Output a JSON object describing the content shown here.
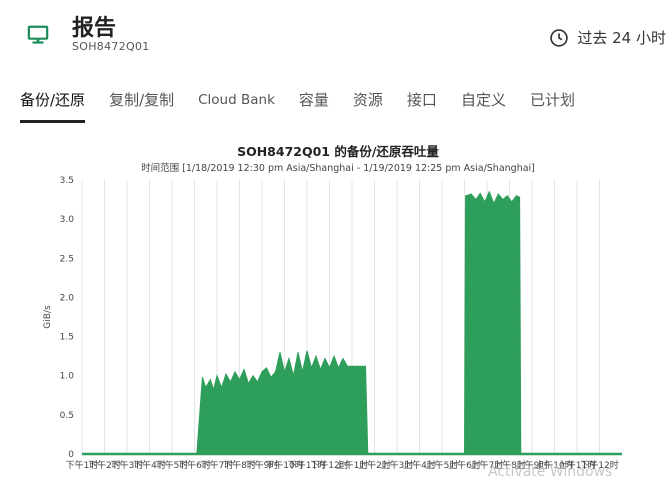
{
  "header": {
    "title": "报告",
    "subtitle": "SOH8472Q01",
    "time_range_label": "过去 24 小时"
  },
  "tabs": [
    {
      "label": "备份/还原",
      "active": true
    },
    {
      "label": "复制/复制",
      "active": false
    },
    {
      "label": "Cloud Bank",
      "active": false
    },
    {
      "label": "容量",
      "active": false
    },
    {
      "label": "资源",
      "active": false
    },
    {
      "label": "接口",
      "active": false
    },
    {
      "label": "自定义",
      "active": false
    },
    {
      "label": "已计划",
      "active": false
    }
  ],
  "watermark": "Activate Windows",
  "colors": {
    "series": "#2e9e5b",
    "accent": "#1e8c5a",
    "grid": "#e4e4e4"
  },
  "chart_data": {
    "type": "area",
    "title": "SOH8472Q01 的备份/还原吞吐量",
    "subtitle": "时间范围 [1/18/2019 12:30 pm Asia/Shanghai - 1/19/2019 12:25 pm Asia/Shanghai]",
    "ylabel": "GiB/s",
    "ylim": [
      0,
      3.5
    ],
    "yticks": [
      "0",
      "0.5",
      "1.0",
      "1.5",
      "2.0",
      "2.5",
      "3.0",
      "3.5"
    ],
    "xticks": [
      "下午1时",
      "下午2时",
      "下午3时",
      "下午4时",
      "下午5时",
      "下午6时",
      "下午7时",
      "下午8时",
      "下午9时",
      "下午10时",
      "下午11时",
      "下午12时",
      "上午1时",
      "上午2时",
      "上午3时",
      "上午4时",
      "上午5时",
      "上午6时",
      "上午7时",
      "上午8时",
      "上午9时",
      "上午10时",
      "上午11时",
      "下午12时"
    ],
    "xlim": [
      0,
      24
    ],
    "grid": true,
    "series": [
      {
        "values": [
          [
            0,
            0
          ],
          [
            5.1,
            0
          ],
          [
            5.35,
            0.98
          ],
          [
            5.5,
            0.85
          ],
          [
            5.7,
            0.95
          ],
          [
            5.85,
            0.82
          ],
          [
            6.0,
            1.0
          ],
          [
            6.2,
            0.85
          ],
          [
            6.4,
            1.02
          ],
          [
            6.6,
            0.92
          ],
          [
            6.8,
            1.05
          ],
          [
            7.0,
            0.95
          ],
          [
            7.2,
            1.08
          ],
          [
            7.4,
            0.9
          ],
          [
            7.6,
            1.0
          ],
          [
            7.8,
            0.92
          ],
          [
            8.0,
            1.05
          ],
          [
            8.2,
            1.1
          ],
          [
            8.4,
            0.98
          ],
          [
            8.6,
            1.05
          ],
          [
            8.8,
            1.3
          ],
          [
            9.0,
            1.05
          ],
          [
            9.2,
            1.22
          ],
          [
            9.4,
            1.0
          ],
          [
            9.6,
            1.3
          ],
          [
            9.8,
            1.05
          ],
          [
            10.0,
            1.32
          ],
          [
            10.2,
            1.1
          ],
          [
            10.4,
            1.25
          ],
          [
            10.6,
            1.08
          ],
          [
            10.8,
            1.22
          ],
          [
            11.0,
            1.1
          ],
          [
            11.2,
            1.25
          ],
          [
            11.4,
            1.1
          ],
          [
            11.6,
            1.22
          ],
          [
            11.8,
            1.12
          ],
          [
            12.0,
            1.12
          ],
          [
            12.6,
            1.12
          ],
          [
            12.7,
            0
          ],
          [
            17.0,
            0
          ],
          [
            17.05,
            3.3
          ],
          [
            17.3,
            3.32
          ],
          [
            17.5,
            3.25
          ],
          [
            17.7,
            3.33
          ],
          [
            17.9,
            3.22
          ],
          [
            18.1,
            3.35
          ],
          [
            18.3,
            3.2
          ],
          [
            18.5,
            3.32
          ],
          [
            18.7,
            3.25
          ],
          [
            18.9,
            3.3
          ],
          [
            19.1,
            3.22
          ],
          [
            19.3,
            3.3
          ],
          [
            19.45,
            3.28
          ],
          [
            19.5,
            0
          ],
          [
            24,
            0
          ]
        ]
      }
    ]
  }
}
